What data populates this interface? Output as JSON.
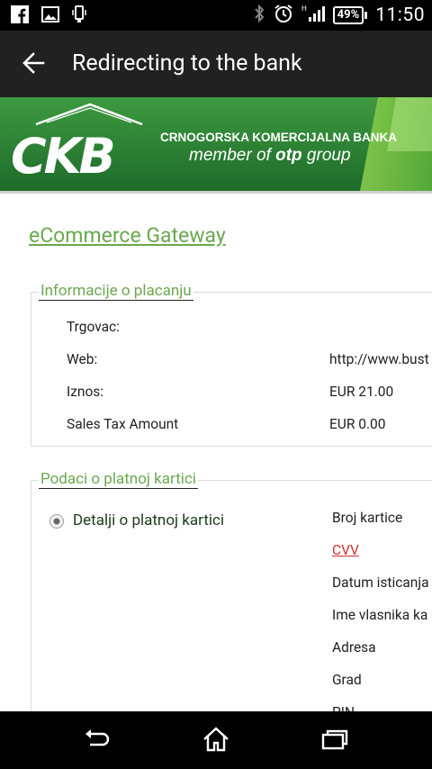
{
  "status_bar": {
    "time": "11:50",
    "battery": "49%",
    "icons": [
      "facebook-icon",
      "image-icon",
      "phone-vibrate-icon",
      "bluetooth-icon",
      "alarm-icon",
      "signal-icon",
      "battery-icon"
    ]
  },
  "app_bar": {
    "title": "Redirecting to the bank",
    "back_icon": "arrow-back-icon"
  },
  "banner": {
    "logo": "CKB",
    "bank_name": "CRNOGORSKA KOMERCIJALNA BANKA",
    "tagline_pre": "member of ",
    "tagline_brand": "otp",
    "tagline_post": " group"
  },
  "page": {
    "gateway_link": "eCommerce Gateway"
  },
  "payment_info": {
    "legend": "Informacije o placanju",
    "rows": [
      {
        "label": "Trgovac:",
        "value": ""
      },
      {
        "label": "Web:",
        "value": "http://www.bust"
      },
      {
        "label": "Iznos:",
        "value": "EUR  21.00"
      },
      {
        "label": "Sales Tax Amount",
        "value": "EUR  0.00"
      }
    ]
  },
  "card_data": {
    "legend": "Podaci o platnoj kartici",
    "option_label": "Detalji o platnoj kartici",
    "fields": [
      "Broj kartice",
      "CVV",
      "Datum isticanja",
      "Ime vlasnika ka",
      "Adresa",
      "Grad",
      "PIN"
    ]
  },
  "colors": {
    "brand_green": "#2e8b3a",
    "link_green": "#6aa84f",
    "cvv_red": "#d32f2f",
    "app_bar": "#212121"
  },
  "nav_bar": {
    "icons": [
      "back-nav-icon",
      "home-icon",
      "recent-apps-icon"
    ]
  }
}
